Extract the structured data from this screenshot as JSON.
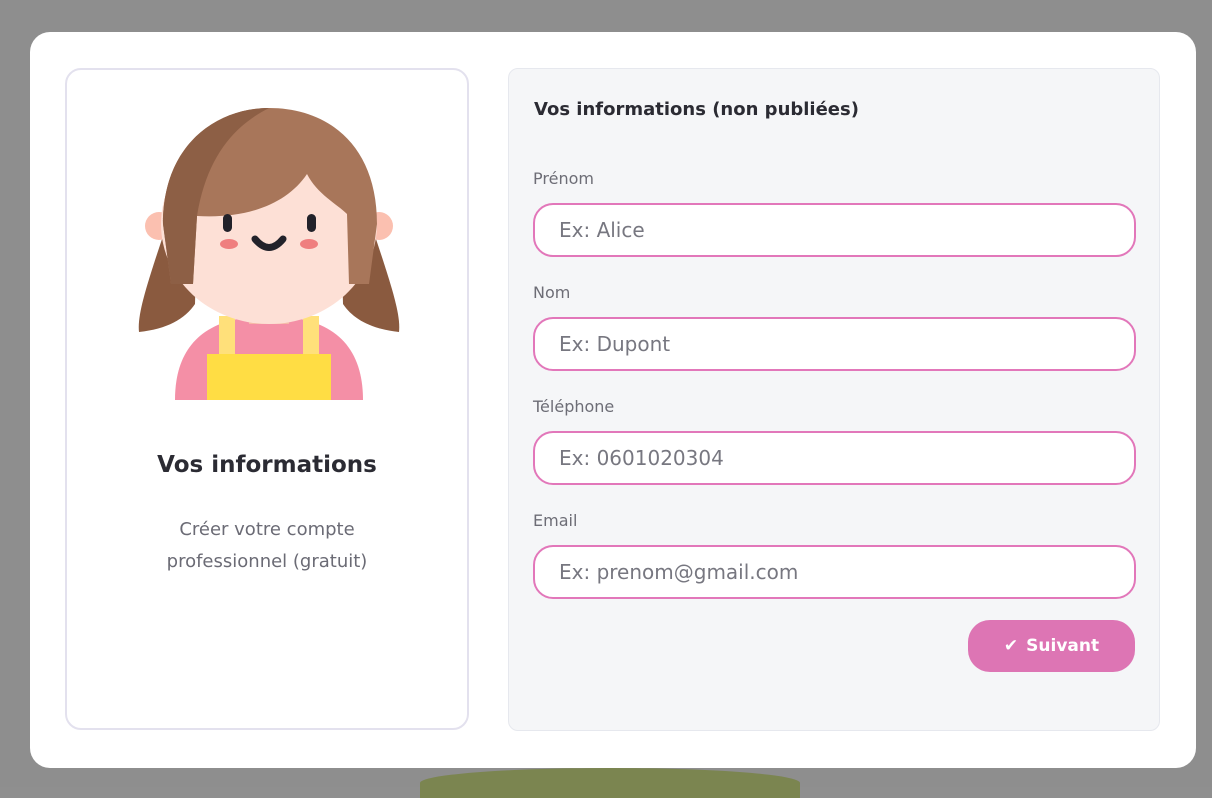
{
  "colors": {
    "accent_pink": "#dd75b4",
    "input_border": "#e277ba",
    "panel_bg": "#f5f6f8",
    "overlay": "#8e8e8e"
  },
  "profile_card": {
    "avatar_icon": "girl-avatar-icon",
    "title": "Vos informations",
    "subtitle": "Créer votre compte professionnel (gratuit)"
  },
  "form": {
    "title": "Vos informations (non publiées)",
    "fields": [
      {
        "label": "Prénom",
        "placeholder": "Ex: Alice",
        "value": ""
      },
      {
        "label": "Nom",
        "placeholder": "Ex: Dupont",
        "value": ""
      },
      {
        "label": "Téléphone",
        "placeholder": "Ex: 0601020304",
        "value": ""
      },
      {
        "label": "Email",
        "placeholder": "Ex: prenom@gmail.com",
        "value": ""
      }
    ],
    "next_button": {
      "icon": "check-icon",
      "icon_glyph": "✔",
      "label": "Suivant"
    }
  }
}
